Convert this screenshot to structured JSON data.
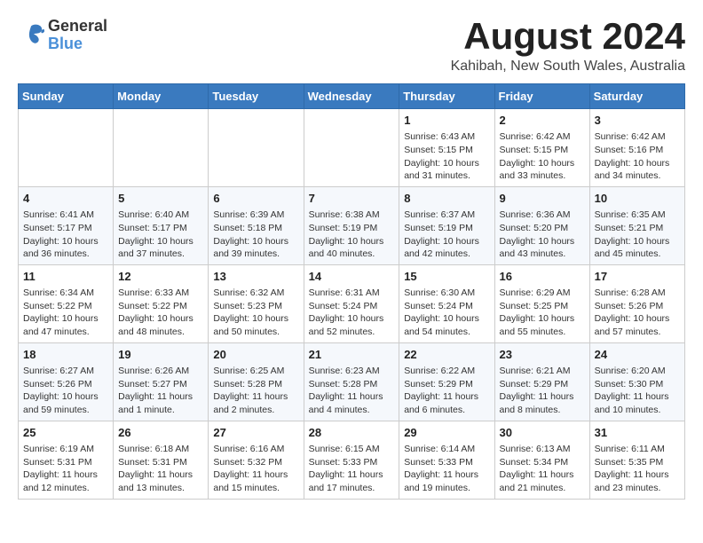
{
  "header": {
    "logo_line1": "General",
    "logo_line2": "Blue",
    "month_year": "August 2024",
    "location": "Kahibah, New South Wales, Australia"
  },
  "weekdays": [
    "Sunday",
    "Monday",
    "Tuesday",
    "Wednesday",
    "Thursday",
    "Friday",
    "Saturday"
  ],
  "weeks": [
    [
      {
        "day": "",
        "info": ""
      },
      {
        "day": "",
        "info": ""
      },
      {
        "day": "",
        "info": ""
      },
      {
        "day": "",
        "info": ""
      },
      {
        "day": "1",
        "info": "Sunrise: 6:43 AM\nSunset: 5:15 PM\nDaylight: 10 hours\nand 31 minutes."
      },
      {
        "day": "2",
        "info": "Sunrise: 6:42 AM\nSunset: 5:15 PM\nDaylight: 10 hours\nand 33 minutes."
      },
      {
        "day": "3",
        "info": "Sunrise: 6:42 AM\nSunset: 5:16 PM\nDaylight: 10 hours\nand 34 minutes."
      }
    ],
    [
      {
        "day": "4",
        "info": "Sunrise: 6:41 AM\nSunset: 5:17 PM\nDaylight: 10 hours\nand 36 minutes."
      },
      {
        "day": "5",
        "info": "Sunrise: 6:40 AM\nSunset: 5:17 PM\nDaylight: 10 hours\nand 37 minutes."
      },
      {
        "day": "6",
        "info": "Sunrise: 6:39 AM\nSunset: 5:18 PM\nDaylight: 10 hours\nand 39 minutes."
      },
      {
        "day": "7",
        "info": "Sunrise: 6:38 AM\nSunset: 5:19 PM\nDaylight: 10 hours\nand 40 minutes."
      },
      {
        "day": "8",
        "info": "Sunrise: 6:37 AM\nSunset: 5:19 PM\nDaylight: 10 hours\nand 42 minutes."
      },
      {
        "day": "9",
        "info": "Sunrise: 6:36 AM\nSunset: 5:20 PM\nDaylight: 10 hours\nand 43 minutes."
      },
      {
        "day": "10",
        "info": "Sunrise: 6:35 AM\nSunset: 5:21 PM\nDaylight: 10 hours\nand 45 minutes."
      }
    ],
    [
      {
        "day": "11",
        "info": "Sunrise: 6:34 AM\nSunset: 5:22 PM\nDaylight: 10 hours\nand 47 minutes."
      },
      {
        "day": "12",
        "info": "Sunrise: 6:33 AM\nSunset: 5:22 PM\nDaylight: 10 hours\nand 48 minutes."
      },
      {
        "day": "13",
        "info": "Sunrise: 6:32 AM\nSunset: 5:23 PM\nDaylight: 10 hours\nand 50 minutes."
      },
      {
        "day": "14",
        "info": "Sunrise: 6:31 AM\nSunset: 5:24 PM\nDaylight: 10 hours\nand 52 minutes."
      },
      {
        "day": "15",
        "info": "Sunrise: 6:30 AM\nSunset: 5:24 PM\nDaylight: 10 hours\nand 54 minutes."
      },
      {
        "day": "16",
        "info": "Sunrise: 6:29 AM\nSunset: 5:25 PM\nDaylight: 10 hours\nand 55 minutes."
      },
      {
        "day": "17",
        "info": "Sunrise: 6:28 AM\nSunset: 5:26 PM\nDaylight: 10 hours\nand 57 minutes."
      }
    ],
    [
      {
        "day": "18",
        "info": "Sunrise: 6:27 AM\nSunset: 5:26 PM\nDaylight: 10 hours\nand 59 minutes."
      },
      {
        "day": "19",
        "info": "Sunrise: 6:26 AM\nSunset: 5:27 PM\nDaylight: 11 hours\nand 1 minute."
      },
      {
        "day": "20",
        "info": "Sunrise: 6:25 AM\nSunset: 5:28 PM\nDaylight: 11 hours\nand 2 minutes."
      },
      {
        "day": "21",
        "info": "Sunrise: 6:23 AM\nSunset: 5:28 PM\nDaylight: 11 hours\nand 4 minutes."
      },
      {
        "day": "22",
        "info": "Sunrise: 6:22 AM\nSunset: 5:29 PM\nDaylight: 11 hours\nand 6 minutes."
      },
      {
        "day": "23",
        "info": "Sunrise: 6:21 AM\nSunset: 5:29 PM\nDaylight: 11 hours\nand 8 minutes."
      },
      {
        "day": "24",
        "info": "Sunrise: 6:20 AM\nSunset: 5:30 PM\nDaylight: 11 hours\nand 10 minutes."
      }
    ],
    [
      {
        "day": "25",
        "info": "Sunrise: 6:19 AM\nSunset: 5:31 PM\nDaylight: 11 hours\nand 12 minutes."
      },
      {
        "day": "26",
        "info": "Sunrise: 6:18 AM\nSunset: 5:31 PM\nDaylight: 11 hours\nand 13 minutes."
      },
      {
        "day": "27",
        "info": "Sunrise: 6:16 AM\nSunset: 5:32 PM\nDaylight: 11 hours\nand 15 minutes."
      },
      {
        "day": "28",
        "info": "Sunrise: 6:15 AM\nSunset: 5:33 PM\nDaylight: 11 hours\nand 17 minutes."
      },
      {
        "day": "29",
        "info": "Sunrise: 6:14 AM\nSunset: 5:33 PM\nDaylight: 11 hours\nand 19 minutes."
      },
      {
        "day": "30",
        "info": "Sunrise: 6:13 AM\nSunset: 5:34 PM\nDaylight: 11 hours\nand 21 minutes."
      },
      {
        "day": "31",
        "info": "Sunrise: 6:11 AM\nSunset: 5:35 PM\nDaylight: 11 hours\nand 23 minutes."
      }
    ]
  ]
}
